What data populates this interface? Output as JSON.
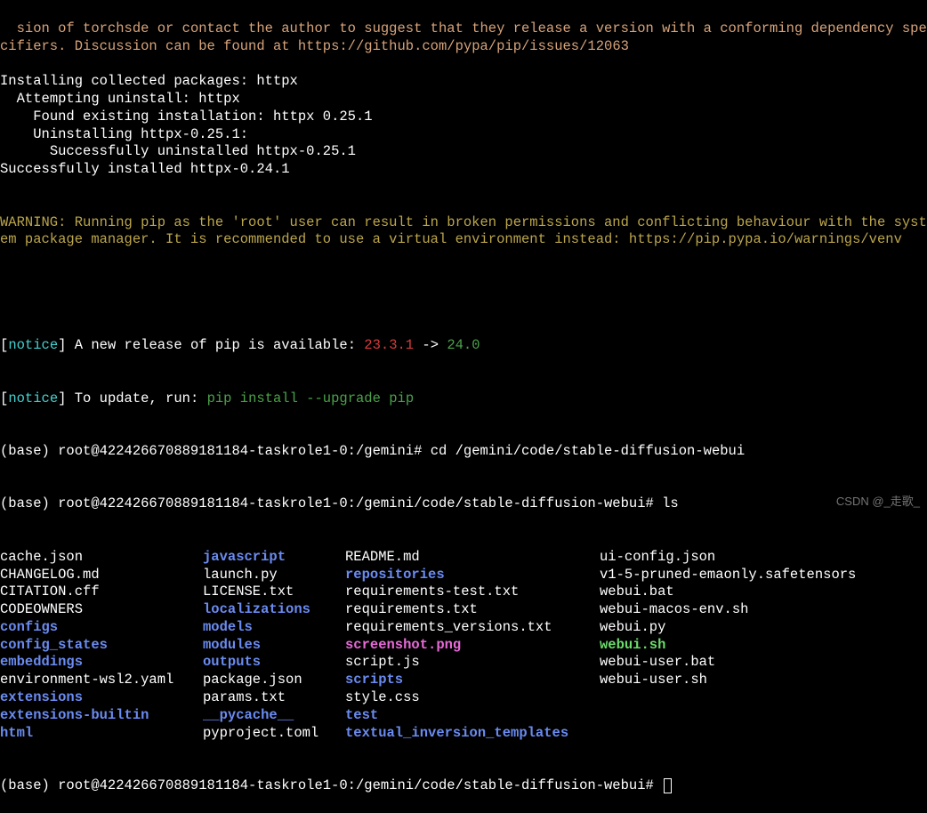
{
  "dep_warning_part1": "sion of torchsde or contact the author to suggest that they release a version with a conforming dependency specifiers. Discussion can be found at ",
  "dep_warning_url": "https://github.com/pypa/pip/issues/12063",
  "install_lines": [
    "Installing collected packages: httpx",
    "  Attempting uninstall: httpx",
    "    Found existing installation: httpx 0.25.1",
    "    Uninstalling httpx-0.25.1:",
    "      Successfully uninstalled httpx-0.25.1",
    "Successfully installed httpx-0.24.1"
  ],
  "root_warning": "WARNING: Running pip as the 'root' user can result in broken permissions and conflicting behaviour with the system package manager. It is recommended to use a virtual environment instead: ",
  "root_warning_url": "https://pip.pypa.io/warnings/venv",
  "notice_label": "notice",
  "notice1_pre": " A new release of pip is available: ",
  "notice1_old": "23.3.1",
  "notice1_arrow": " -> ",
  "notice1_new": "24.0",
  "notice2_pre": " To update, run: ",
  "notice2_cmd": "pip install --upgrade pip",
  "prompt1_prefix": "(base) root@422426670889181184-taskrole1-0:/gemini# ",
  "prompt1_cmd": "cd /gemini/code/stable-diffusion-webui",
  "prompt2_prefix": "(base) root@422426670889181184-taskrole1-0:/gemini/code/stable-diffusion-webui# ",
  "prompt2_cmd": "ls",
  "ls": [
    [
      {
        "t": "cache.json",
        "c": "white"
      },
      {
        "t": "javascript",
        "c": "bluebold"
      },
      {
        "t": "README.md",
        "c": "white"
      },
      {
        "t": "ui-config.json",
        "c": "white"
      }
    ],
    [
      {
        "t": "CHANGELOG.md",
        "c": "white"
      },
      {
        "t": "launch.py",
        "c": "white"
      },
      {
        "t": "repositories",
        "c": "bluebold"
      },
      {
        "t": "v1-5-pruned-emaonly.safetensors",
        "c": "white"
      }
    ],
    [
      {
        "t": "CITATION.cff",
        "c": "white"
      },
      {
        "t": "LICENSE.txt",
        "c": "white"
      },
      {
        "t": "requirements-test.txt",
        "c": "white"
      },
      {
        "t": "webui.bat",
        "c": "white"
      }
    ],
    [
      {
        "t": "CODEOWNERS",
        "c": "white"
      },
      {
        "t": "localizations",
        "c": "bluebold"
      },
      {
        "t": "requirements.txt",
        "c": "white"
      },
      {
        "t": "webui-macos-env.sh",
        "c": "white"
      }
    ],
    [
      {
        "t": "configs",
        "c": "bluebold"
      },
      {
        "t": "models",
        "c": "bluebold"
      },
      {
        "t": "requirements_versions.txt",
        "c": "white"
      },
      {
        "t": "webui.py",
        "c": "white"
      }
    ],
    [
      {
        "t": "config_states",
        "c": "bluebold"
      },
      {
        "t": "modules",
        "c": "bluebold"
      },
      {
        "t": "screenshot.png",
        "c": "magentabold"
      },
      {
        "t": "webui.sh",
        "c": "limebold"
      }
    ],
    [
      {
        "t": "embeddings",
        "c": "bluebold"
      },
      {
        "t": "outputs",
        "c": "bluebold"
      },
      {
        "t": "script.js",
        "c": "white"
      },
      {
        "t": "webui-user.bat",
        "c": "white"
      }
    ],
    [
      {
        "t": "environment-wsl2.yaml",
        "c": "white"
      },
      {
        "t": "package.json",
        "c": "white"
      },
      {
        "t": "scripts",
        "c": "bluebold"
      },
      {
        "t": "webui-user.sh",
        "c": "white"
      }
    ],
    [
      {
        "t": "extensions",
        "c": "bluebold"
      },
      {
        "t": "params.txt",
        "c": "white"
      },
      {
        "t": "style.css",
        "c": "white"
      },
      {
        "t": "",
        "c": "white"
      }
    ],
    [
      {
        "t": "extensions-builtin",
        "c": "bluebold"
      },
      {
        "t": "__pycache__",
        "c": "bluebold"
      },
      {
        "t": "test",
        "c": "bluebold"
      },
      {
        "t": "",
        "c": "white"
      }
    ],
    [
      {
        "t": "html",
        "c": "bluebold"
      },
      {
        "t": "pyproject.toml",
        "c": "white"
      },
      {
        "t": "textual_inversion_templates",
        "c": "bluebold"
      },
      {
        "t": "",
        "c": "white"
      }
    ]
  ],
  "prompt3_prefix": "(base) root@422426670889181184-taskrole1-0:/gemini/code/stable-diffusion-webui# ",
  "watermark": "CSDN @_走歌_"
}
